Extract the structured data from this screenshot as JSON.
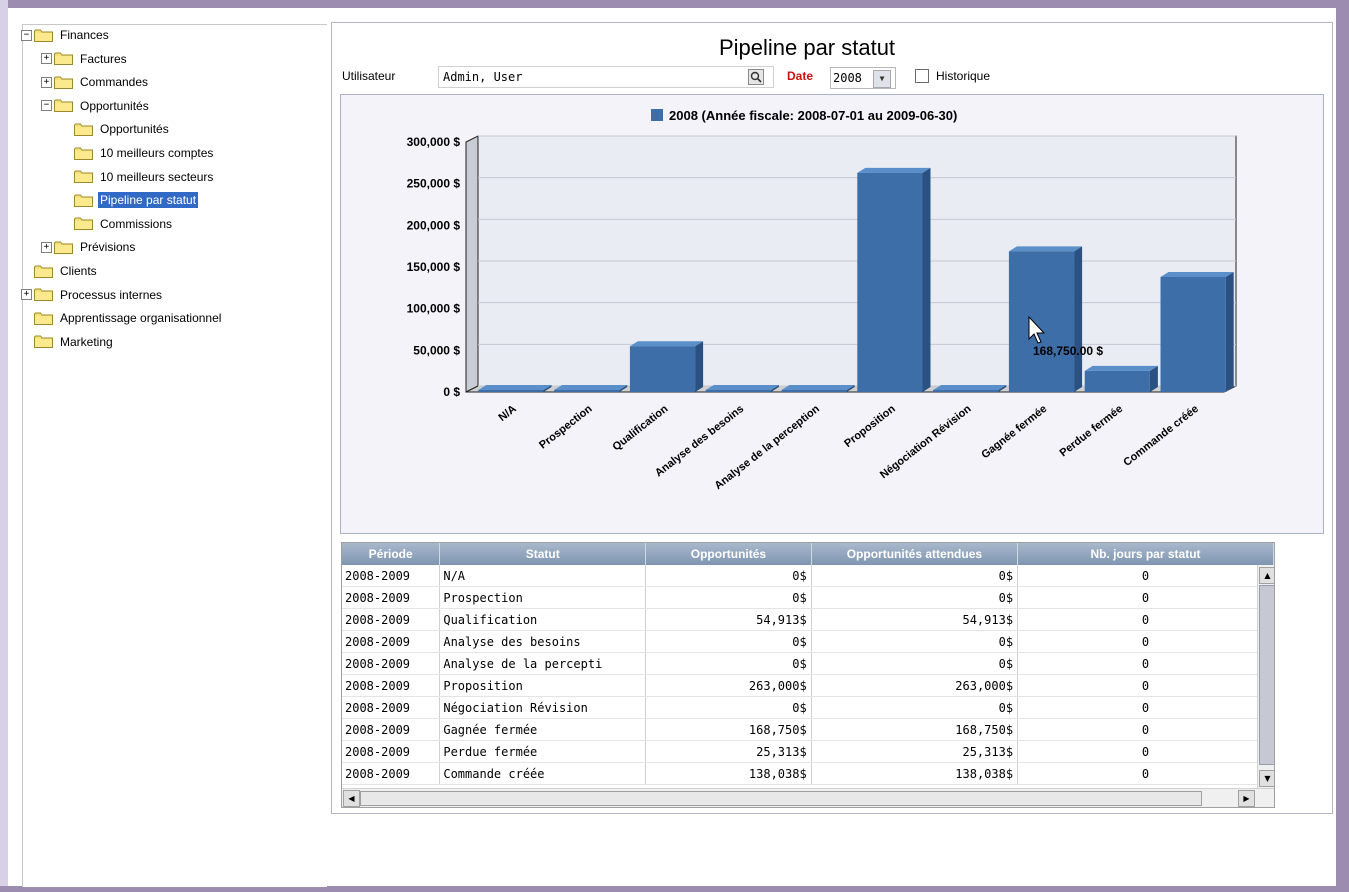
{
  "tree": {
    "items": [
      {
        "label": "Finances",
        "expander": "−",
        "level": 0
      },
      {
        "label": "Factures",
        "expander": "+",
        "level": 1
      },
      {
        "label": "Commandes",
        "expander": "+",
        "level": 1
      },
      {
        "label": "Opportunités",
        "expander": "−",
        "level": 1
      },
      {
        "label": "Opportunités",
        "expander": "",
        "level": 2
      },
      {
        "label": "10 meilleurs comptes",
        "expander": "",
        "level": 2
      },
      {
        "label": "10 meilleurs secteurs",
        "expander": "",
        "level": 2
      },
      {
        "label": "Pipeline par statut",
        "expander": "",
        "level": 2,
        "selected": true
      },
      {
        "label": "Commissions",
        "expander": "",
        "level": 2
      },
      {
        "label": "Prévisions",
        "expander": "+",
        "level": 1
      },
      {
        "label": "Clients",
        "expander": "",
        "level": 0
      },
      {
        "label": "Processus internes",
        "expander": "+",
        "level": 0
      },
      {
        "label": "Apprentissage organisationnel",
        "expander": "",
        "level": 0
      },
      {
        "label": "Marketing",
        "expander": "",
        "level": 0
      }
    ]
  },
  "header": {
    "title": "Pipeline par statut",
    "user_label": "Utilisateur",
    "user_value": "Admin, User",
    "date_label": "Date",
    "date_value": "2008",
    "history_label": "Historique"
  },
  "colors": {
    "bar": "#3d6ea8",
    "bar_top": "#5b8fca",
    "bar_side": "#2a5182",
    "date_label": "#d01010",
    "table_header": "#8fa3bd",
    "selection": "#316ac5"
  },
  "chart_data": {
    "type": "bar",
    "title": "",
    "legend": "2008 (Année fiscale: 2008-07-01 au 2009-06-30)",
    "categories": [
      "N/A",
      "Prospection",
      "Qualification",
      "Analyse des besoins",
      "Analyse de la perception",
      "Proposition",
      "Négociation Révision",
      "Gagnée fermée",
      "Perdue fermée",
      "Commande créée"
    ],
    "values": [
      0,
      0,
      54913,
      0,
      0,
      263000,
      0,
      168750,
      25313,
      138038
    ],
    "ytick_labels": [
      "300,000 $",
      "250,000 $",
      "200,000 $",
      "150,000 $",
      "100,000 $",
      "50,000 $",
      "0 $"
    ],
    "ylim": [
      0,
      300000
    ],
    "tooltip": "168,750.00 $"
  },
  "table": {
    "headers": [
      "Période",
      "Statut",
      "Opportunités",
      "Opportunités attendues",
      "Nb. jours par statut"
    ],
    "rows": [
      [
        "2008-2009",
        "N/A",
        "0$",
        "0$",
        "0"
      ],
      [
        "2008-2009",
        "Prospection",
        "0$",
        "0$",
        "0"
      ],
      [
        "2008-2009",
        "Qualification",
        "54,913$",
        "54,913$",
        "0"
      ],
      [
        "2008-2009",
        "Analyse des besoins",
        "0$",
        "0$",
        "0"
      ],
      [
        "2008-2009",
        "Analyse de la percepti",
        "0$",
        "0$",
        "0"
      ],
      [
        "2008-2009",
        "Proposition",
        "263,000$",
        "263,000$",
        "0"
      ],
      [
        "2008-2009",
        "Négociation Révision",
        "0$",
        "0$",
        "0"
      ],
      [
        "2008-2009",
        "Gagnée fermée",
        "168,750$",
        "168,750$",
        "0"
      ],
      [
        "2008-2009",
        "Perdue fermée",
        "25,313$",
        "25,313$",
        "0"
      ],
      [
        "2008-2009",
        "Commande créée",
        "138,038$",
        "138,038$",
        "0"
      ]
    ]
  }
}
